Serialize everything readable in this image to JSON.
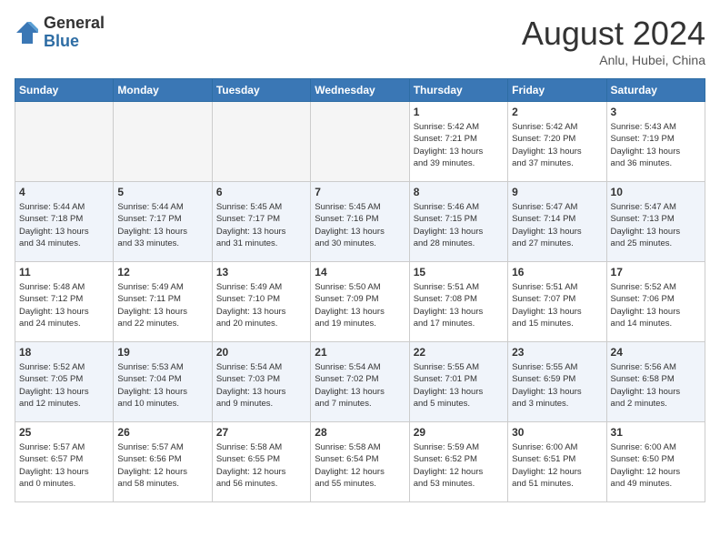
{
  "header": {
    "logo_general": "General",
    "logo_blue": "Blue",
    "month_title": "August 2024",
    "location": "Anlu, Hubei, China"
  },
  "calendar": {
    "days_of_week": [
      "Sunday",
      "Monday",
      "Tuesday",
      "Wednesday",
      "Thursday",
      "Friday",
      "Saturday"
    ],
    "weeks": [
      [
        {
          "day": "",
          "info": ""
        },
        {
          "day": "",
          "info": ""
        },
        {
          "day": "",
          "info": ""
        },
        {
          "day": "",
          "info": ""
        },
        {
          "day": "1",
          "info": "Sunrise: 5:42 AM\nSunset: 7:21 PM\nDaylight: 13 hours\nand 39 minutes."
        },
        {
          "day": "2",
          "info": "Sunrise: 5:42 AM\nSunset: 7:20 PM\nDaylight: 13 hours\nand 37 minutes."
        },
        {
          "day": "3",
          "info": "Sunrise: 5:43 AM\nSunset: 7:19 PM\nDaylight: 13 hours\nand 36 minutes."
        }
      ],
      [
        {
          "day": "4",
          "info": "Sunrise: 5:44 AM\nSunset: 7:18 PM\nDaylight: 13 hours\nand 34 minutes."
        },
        {
          "day": "5",
          "info": "Sunrise: 5:44 AM\nSunset: 7:17 PM\nDaylight: 13 hours\nand 33 minutes."
        },
        {
          "day": "6",
          "info": "Sunrise: 5:45 AM\nSunset: 7:17 PM\nDaylight: 13 hours\nand 31 minutes."
        },
        {
          "day": "7",
          "info": "Sunrise: 5:45 AM\nSunset: 7:16 PM\nDaylight: 13 hours\nand 30 minutes."
        },
        {
          "day": "8",
          "info": "Sunrise: 5:46 AM\nSunset: 7:15 PM\nDaylight: 13 hours\nand 28 minutes."
        },
        {
          "day": "9",
          "info": "Sunrise: 5:47 AM\nSunset: 7:14 PM\nDaylight: 13 hours\nand 27 minutes."
        },
        {
          "day": "10",
          "info": "Sunrise: 5:47 AM\nSunset: 7:13 PM\nDaylight: 13 hours\nand 25 minutes."
        }
      ],
      [
        {
          "day": "11",
          "info": "Sunrise: 5:48 AM\nSunset: 7:12 PM\nDaylight: 13 hours\nand 24 minutes."
        },
        {
          "day": "12",
          "info": "Sunrise: 5:49 AM\nSunset: 7:11 PM\nDaylight: 13 hours\nand 22 minutes."
        },
        {
          "day": "13",
          "info": "Sunrise: 5:49 AM\nSunset: 7:10 PM\nDaylight: 13 hours\nand 20 minutes."
        },
        {
          "day": "14",
          "info": "Sunrise: 5:50 AM\nSunset: 7:09 PM\nDaylight: 13 hours\nand 19 minutes."
        },
        {
          "day": "15",
          "info": "Sunrise: 5:51 AM\nSunset: 7:08 PM\nDaylight: 13 hours\nand 17 minutes."
        },
        {
          "day": "16",
          "info": "Sunrise: 5:51 AM\nSunset: 7:07 PM\nDaylight: 13 hours\nand 15 minutes."
        },
        {
          "day": "17",
          "info": "Sunrise: 5:52 AM\nSunset: 7:06 PM\nDaylight: 13 hours\nand 14 minutes."
        }
      ],
      [
        {
          "day": "18",
          "info": "Sunrise: 5:52 AM\nSunset: 7:05 PM\nDaylight: 13 hours\nand 12 minutes."
        },
        {
          "day": "19",
          "info": "Sunrise: 5:53 AM\nSunset: 7:04 PM\nDaylight: 13 hours\nand 10 minutes."
        },
        {
          "day": "20",
          "info": "Sunrise: 5:54 AM\nSunset: 7:03 PM\nDaylight: 13 hours\nand 9 minutes."
        },
        {
          "day": "21",
          "info": "Sunrise: 5:54 AM\nSunset: 7:02 PM\nDaylight: 13 hours\nand 7 minutes."
        },
        {
          "day": "22",
          "info": "Sunrise: 5:55 AM\nSunset: 7:01 PM\nDaylight: 13 hours\nand 5 minutes."
        },
        {
          "day": "23",
          "info": "Sunrise: 5:55 AM\nSunset: 6:59 PM\nDaylight: 13 hours\nand 3 minutes."
        },
        {
          "day": "24",
          "info": "Sunrise: 5:56 AM\nSunset: 6:58 PM\nDaylight: 13 hours\nand 2 minutes."
        }
      ],
      [
        {
          "day": "25",
          "info": "Sunrise: 5:57 AM\nSunset: 6:57 PM\nDaylight: 13 hours\nand 0 minutes."
        },
        {
          "day": "26",
          "info": "Sunrise: 5:57 AM\nSunset: 6:56 PM\nDaylight: 12 hours\nand 58 minutes."
        },
        {
          "day": "27",
          "info": "Sunrise: 5:58 AM\nSunset: 6:55 PM\nDaylight: 12 hours\nand 56 minutes."
        },
        {
          "day": "28",
          "info": "Sunrise: 5:58 AM\nSunset: 6:54 PM\nDaylight: 12 hours\nand 55 minutes."
        },
        {
          "day": "29",
          "info": "Sunrise: 5:59 AM\nSunset: 6:52 PM\nDaylight: 12 hours\nand 53 minutes."
        },
        {
          "day": "30",
          "info": "Sunrise: 6:00 AM\nSunset: 6:51 PM\nDaylight: 12 hours\nand 51 minutes."
        },
        {
          "day": "31",
          "info": "Sunrise: 6:00 AM\nSunset: 6:50 PM\nDaylight: 12 hours\nand 49 minutes."
        }
      ]
    ]
  }
}
